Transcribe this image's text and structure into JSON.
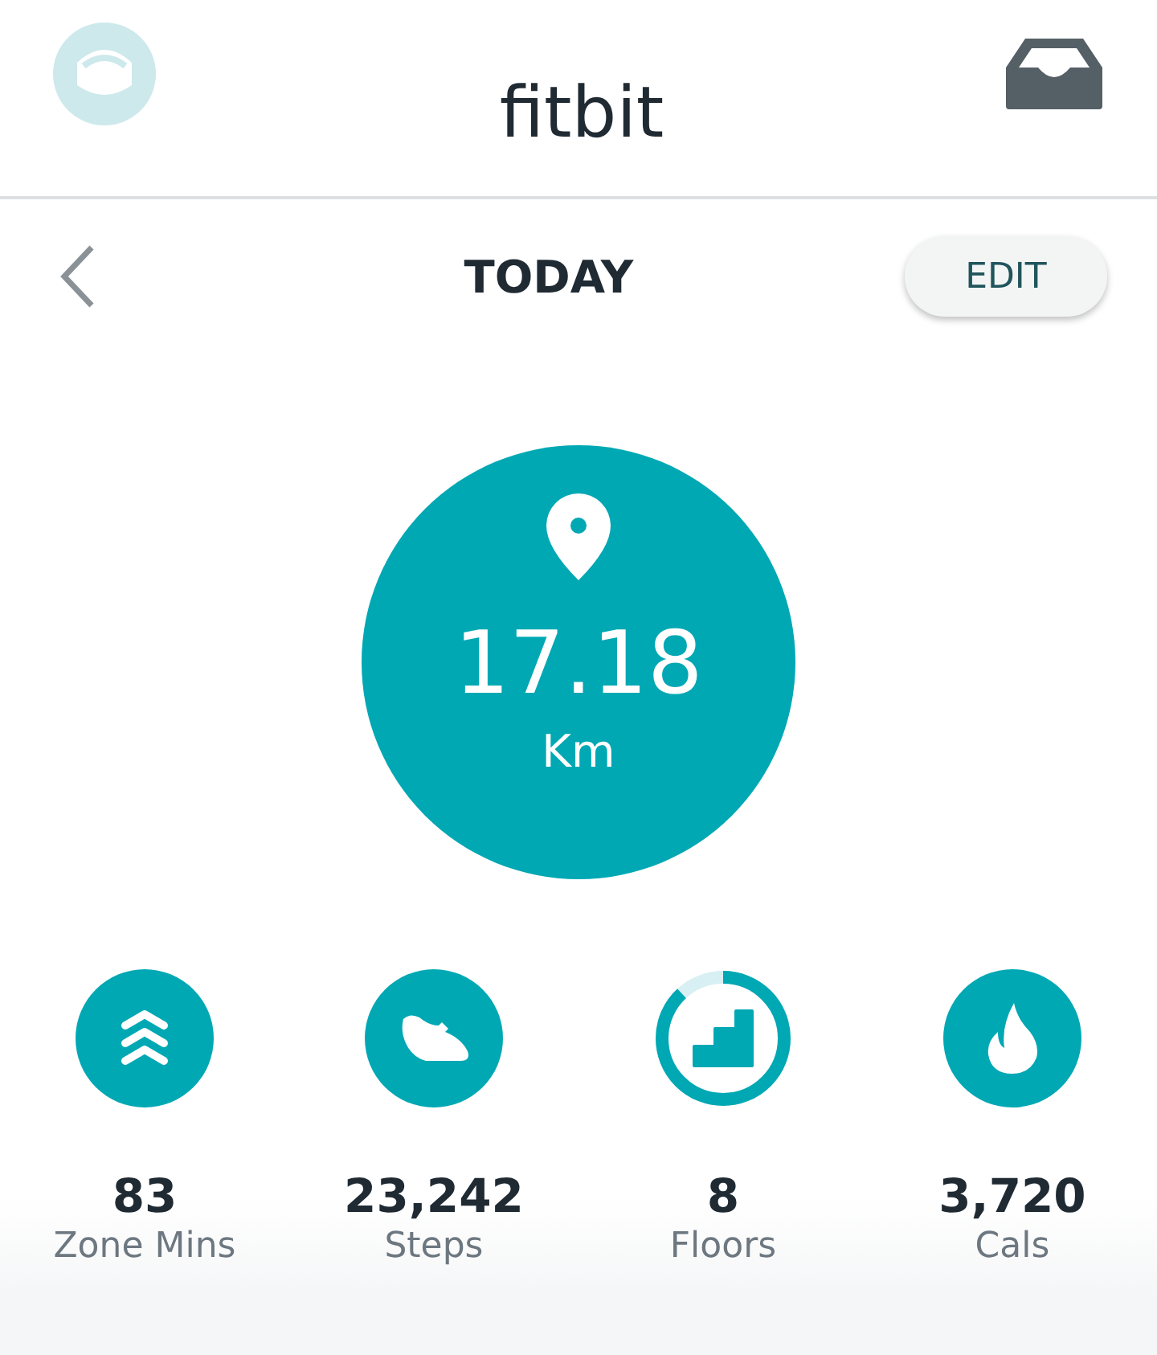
{
  "header": {
    "title": "fitbit"
  },
  "toolbar": {
    "title": "TODAY",
    "edit_button": "EDIT"
  },
  "hero": {
    "value": "17.18",
    "unit": "Km"
  },
  "stats": [
    {
      "kind": "zone",
      "value": "83",
      "label": "Zone Mins"
    },
    {
      "kind": "steps",
      "value": "23,242",
      "label": "Steps"
    },
    {
      "kind": "floors",
      "value": "8",
      "label": "Floors"
    },
    {
      "kind": "cals",
      "value": "3,720",
      "label": "Cals"
    }
  ]
}
